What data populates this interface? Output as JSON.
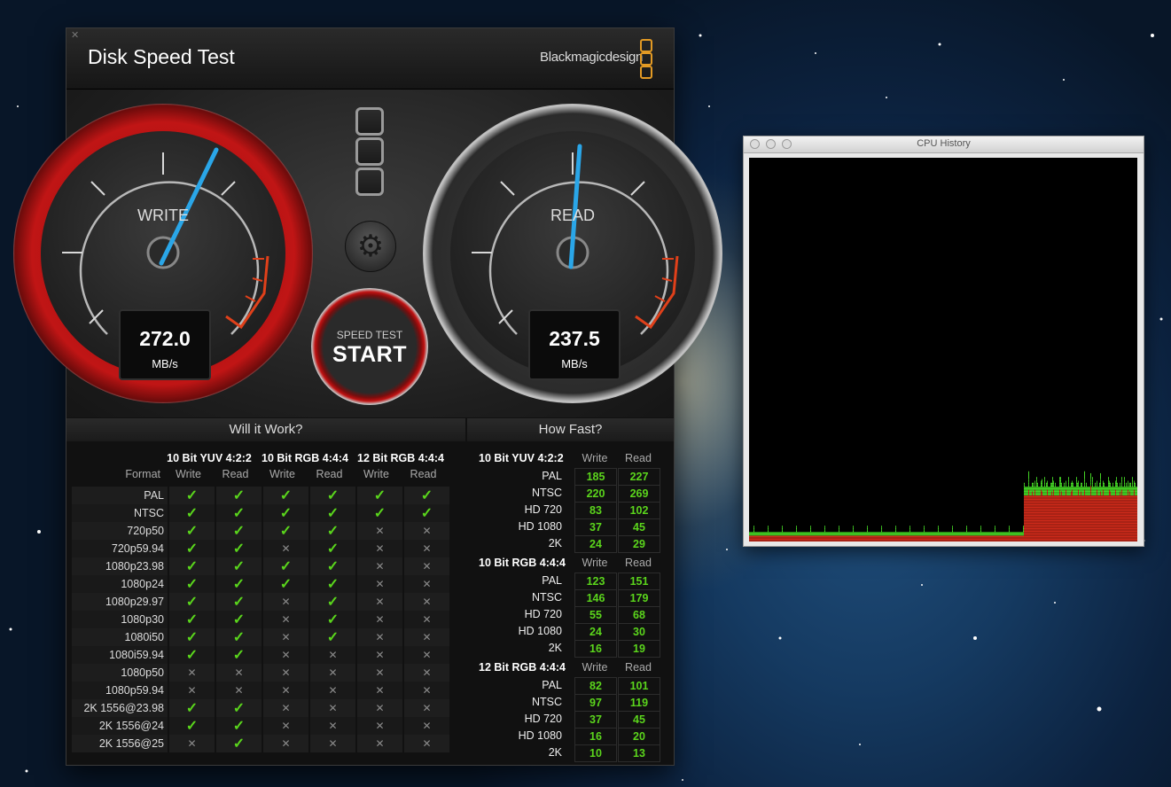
{
  "disk_speed_test": {
    "title": "Disk Speed Test",
    "brand": "Blackmagicdesign",
    "write_gauge": {
      "label": "WRITE",
      "value": "272.0",
      "unit": "MB/s"
    },
    "read_gauge": {
      "label": "READ",
      "value": "237.5",
      "unit": "MB/s"
    },
    "start_button": {
      "line1": "SPEED TEST",
      "line2": "START"
    },
    "will_it_work": {
      "title": "Will it Work?",
      "format_header": "Format",
      "groups": [
        "10 Bit YUV 4:2:2",
        "10 Bit RGB 4:4:4",
        "12 Bit RGB 4:4:4"
      ],
      "col_write": "Write",
      "col_read": "Read",
      "rows": [
        {
          "format": "PAL",
          "v": [
            1,
            1,
            1,
            1,
            1,
            1
          ]
        },
        {
          "format": "NTSC",
          "v": [
            1,
            1,
            1,
            1,
            1,
            1
          ]
        },
        {
          "format": "720p50",
          "v": [
            1,
            1,
            1,
            1,
            0,
            0
          ]
        },
        {
          "format": "720p59.94",
          "v": [
            1,
            1,
            0,
            1,
            0,
            0
          ]
        },
        {
          "format": "1080p23.98",
          "v": [
            1,
            1,
            1,
            1,
            0,
            0
          ]
        },
        {
          "format": "1080p24",
          "v": [
            1,
            1,
            1,
            1,
            0,
            0
          ]
        },
        {
          "format": "1080p29.97",
          "v": [
            1,
            1,
            0,
            1,
            0,
            0
          ]
        },
        {
          "format": "1080p30",
          "v": [
            1,
            1,
            0,
            1,
            0,
            0
          ]
        },
        {
          "format": "1080i50",
          "v": [
            1,
            1,
            0,
            1,
            0,
            0
          ]
        },
        {
          "format": "1080i59.94",
          "v": [
            1,
            1,
            0,
            0,
            0,
            0
          ]
        },
        {
          "format": "1080p50",
          "v": [
            0,
            0,
            0,
            0,
            0,
            0
          ]
        },
        {
          "format": "1080p59.94",
          "v": [
            0,
            0,
            0,
            0,
            0,
            0
          ]
        },
        {
          "format": "2K 1556@23.98",
          "v": [
            1,
            1,
            0,
            0,
            0,
            0
          ]
        },
        {
          "format": "2K 1556@24",
          "v": [
            1,
            1,
            0,
            0,
            0,
            0
          ]
        },
        {
          "format": "2K 1556@25",
          "v": [
            0,
            1,
            0,
            0,
            0,
            0
          ]
        }
      ],
      "check_symbol": "✓",
      "cross_symbol": "✕"
    },
    "how_fast": {
      "title": "How Fast?",
      "col_write": "Write",
      "col_read": "Read",
      "groups": [
        {
          "name": "10 Bit YUV 4:2:2",
          "rows": [
            {
              "label": "PAL",
              "write": "185",
              "read": "227"
            },
            {
              "label": "NTSC",
              "write": "220",
              "read": "269"
            },
            {
              "label": "HD 720",
              "write": "83",
              "read": "102"
            },
            {
              "label": "HD 1080",
              "write": "37",
              "read": "45"
            },
            {
              "label": "2K",
              "write": "24",
              "read": "29"
            }
          ]
        },
        {
          "name": "10 Bit RGB 4:4:4",
          "rows": [
            {
              "label": "PAL",
              "write": "123",
              "read": "151"
            },
            {
              "label": "NTSC",
              "write": "146",
              "read": "179"
            },
            {
              "label": "HD 720",
              "write": "55",
              "read": "68"
            },
            {
              "label": "HD 1080",
              "write": "24",
              "read": "30"
            },
            {
              "label": "2K",
              "write": "16",
              "read": "19"
            }
          ]
        },
        {
          "name": "12 Bit RGB 4:4:4",
          "rows": [
            {
              "label": "PAL",
              "write": "82",
              "read": "101"
            },
            {
              "label": "NTSC",
              "write": "97",
              "read": "119"
            },
            {
              "label": "HD 720",
              "write": "37",
              "read": "45"
            },
            {
              "label": "HD 1080",
              "write": "16",
              "read": "20"
            },
            {
              "label": "2K",
              "write": "10",
              "read": "13"
            }
          ]
        }
      ]
    }
  },
  "cpu_history": {
    "title": "CPU History",
    "colors": {
      "user": "#cc2a1a",
      "system": "#44d425",
      "background": "#000000"
    },
    "user_series": [
      3,
      3,
      3,
      3,
      3,
      3,
      3,
      3,
      3,
      3,
      3,
      3,
      3,
      3,
      3,
      3,
      3,
      3,
      3,
      3,
      3,
      3,
      3,
      3,
      3,
      3,
      3,
      3,
      3,
      3,
      3,
      3,
      3,
      3,
      3,
      3,
      3,
      3,
      3,
      3,
      3,
      3,
      3,
      3,
      3,
      3,
      3,
      3,
      3,
      3,
      3,
      3,
      3,
      3,
      3,
      3,
      3,
      3,
      3,
      3,
      3,
      3,
      3,
      3,
      3,
      3,
      3,
      3,
      3,
      3,
      3,
      3,
      3,
      3,
      3,
      3,
      3,
      3,
      3,
      3,
      3,
      3,
      3,
      3,
      3,
      3,
      3,
      3,
      3,
      3,
      3,
      3,
      3,
      3,
      3,
      3,
      3,
      3,
      3,
      3,
      3,
      3,
      3,
      3,
      3,
      3,
      3,
      3,
      3,
      3,
      3,
      3,
      3,
      3,
      3,
      3,
      3,
      3,
      3,
      3,
      3,
      3,
      3,
      3,
      3,
      3,
      3,
      3,
      3,
      3,
      3,
      3,
      3,
      3,
      3,
      3,
      3,
      3,
      3,
      3,
      3,
      3,
      3,
      3,
      3,
      3,
      3,
      3,
      3,
      3,
      3,
      3,
      3,
      3,
      3,
      3,
      3,
      3,
      3,
      3,
      3,
      3,
      3,
      3,
      3,
      3,
      3,
      3,
      3,
      3,
      3,
      3,
      3,
      3,
      3,
      3,
      3,
      3,
      3,
      3,
      3,
      3,
      3,
      3,
      3,
      3,
      3,
      3,
      3,
      3,
      3,
      3,
      3,
      3,
      3,
      3,
      3,
      3,
      3,
      3,
      3,
      3,
      3,
      3,
      3,
      3,
      3,
      3,
      3,
      3,
      3,
      3,
      3,
      3,
      3,
      3,
      3,
      3,
      3,
      3,
      3,
      3,
      3,
      3,
      3,
      3,
      3,
      3,
      3,
      3,
      3,
      3,
      3,
      3,
      3,
      3,
      3,
      3,
      3,
      3,
      3,
      3,
      3,
      3,
      3,
      3,
      3,
      3,
      3,
      3,
      3,
      3,
      3,
      3,
      3,
      3,
      3,
      3,
      3,
      3,
      3,
      3,
      3,
      3,
      3,
      3,
      3,
      3,
      3,
      3,
      3,
      3,
      3,
      3,
      3,
      3,
      3,
      3,
      3,
      3,
      3,
      3,
      3,
      3,
      3,
      3,
      3,
      3,
      3,
      3,
      3,
      3,
      3,
      3,
      3,
      3,
      3,
      3,
      3,
      3,
      3,
      3,
      3,
      3,
      3,
      3,
      3,
      3,
      3,
      3,
      3,
      3,
      3,
      3,
      3,
      3,
      3,
      3,
      3,
      3,
      3,
      3,
      3,
      3,
      3,
      3,
      3,
      3,
      3,
      3,
      3,
      3,
      3,
      3,
      3,
      3,
      3,
      3,
      3,
      3,
      3,
      3,
      3,
      3,
      3,
      3,
      3,
      3,
      3,
      3,
      3,
      3,
      3,
      3,
      3,
      3,
      3,
      3,
      3,
      3,
      3,
      3,
      3,
      3,
      3,
      3,
      3,
      3,
      3,
      3,
      3,
      3,
      3,
      3,
      3,
      3,
      3,
      3,
      3,
      3,
      3,
      3,
      3,
      3,
      3,
      3,
      3,
      3,
      3,
      3,
      3,
      3,
      3,
      3,
      3,
      3,
      3,
      3,
      3,
      3,
      3,
      3,
      3,
      3,
      3,
      3,
      3,
      3,
      3,
      3,
      3,
      3,
      3,
      3,
      3,
      3,
      3,
      3,
      3,
      3,
      3,
      3,
      3,
      3,
      3,
      3,
      3,
      3,
      3,
      3,
      3,
      3,
      3,
      3,
      3,
      3,
      3,
      3,
      3,
      3,
      3,
      3,
      3,
      3,
      3,
      3,
      3,
      3,
      3,
      3,
      3,
      3,
      3,
      3,
      3,
      3,
      3,
      3,
      3,
      3,
      3,
      3,
      3,
      3,
      3,
      3,
      3,
      3
    ],
    "system_series": [
      1,
      1,
      1,
      1,
      1,
      1,
      1,
      1,
      1,
      1,
      1,
      1,
      2,
      1,
      1,
      1,
      1,
      1,
      1,
      1,
      1,
      1,
      1,
      1,
      1,
      2,
      1,
      1,
      1,
      1,
      1,
      1,
      1,
      1,
      1,
      1,
      1,
      1,
      1,
      1,
      1,
      1,
      1,
      1,
      1,
      1,
      1,
      1,
      1,
      1,
      1,
      1,
      1,
      1,
      1,
      1,
      1,
      1,
      1,
      1,
      1,
      1,
      1,
      1,
      1,
      1,
      1,
      1,
      1,
      1,
      1,
      1,
      1,
      1,
      1,
      1,
      1,
      1,
      1,
      1,
      1,
      1,
      1,
      1,
      1,
      1,
      1,
      1,
      1,
      1,
      1,
      1,
      1,
      1,
      1,
      1,
      1,
      1,
      1,
      1,
      1,
      1,
      1,
      1,
      1,
      1,
      1,
      1,
      1,
      1,
      1,
      1,
      1,
      1,
      1,
      1,
      1,
      1,
      1,
      1,
      1,
      1,
      1,
      1,
      1,
      1,
      1,
      1,
      1,
      1,
      1,
      1,
      1,
      1,
      1,
      1,
      1,
      1,
      1,
      1,
      1,
      1,
      1,
      1,
      1,
      1,
      1,
      1,
      1,
      1,
      1,
      1,
      1,
      1,
      1,
      1,
      1,
      1,
      1,
      1,
      1,
      1,
      1,
      1,
      1,
      1,
      1,
      1,
      1,
      1,
      1,
      1,
      1,
      1,
      1,
      1,
      1,
      1,
      1,
      1,
      1,
      1,
      1,
      1,
      1,
      1,
      1,
      1,
      1,
      1,
      1,
      1,
      1,
      1,
      1,
      1,
      1,
      1,
      1,
      1,
      1,
      1,
      1,
      1,
      1,
      1,
      1,
      1,
      1,
      1,
      1,
      1,
      1,
      1,
      1,
      1,
      1,
      1,
      1,
      1,
      1,
      1,
      1,
      1,
      1,
      1,
      1,
      1,
      1,
      1,
      1,
      1,
      1,
      1,
      1,
      1,
      1,
      1,
      1,
      1,
      1,
      1,
      1,
      1,
      1,
      1,
      1,
      1,
      1,
      1,
      1,
      1,
      1,
      1,
      1,
      1,
      1,
      1,
      1,
      1,
      1,
      1,
      1,
      1,
      1,
      1,
      1,
      1,
      1,
      1,
      1,
      1,
      1,
      1,
      1,
      1,
      1,
      1,
      1,
      1,
      1,
      1,
      1,
      1,
      1,
      1,
      1,
      1,
      1,
      1,
      1,
      1,
      1,
      1,
      1,
      1,
      1,
      1,
      1,
      1,
      1,
      1,
      1,
      1,
      1,
      1,
      1,
      1,
      1,
      1,
      1,
      1,
      1,
      1,
      1,
      1,
      1,
      1,
      1,
      1,
      1,
      1,
      1,
      1,
      1,
      1,
      1,
      1,
      1,
      1,
      1,
      1,
      1,
      1,
      1,
      1,
      1,
      1,
      1,
      1,
      1,
      1,
      1,
      1,
      1,
      1,
      1,
      1,
      1,
      1,
      1,
      1,
      1,
      1,
      1,
      1,
      1,
      1,
      1,
      1,
      1,
      1,
      1,
      1,
      1,
      1,
      1,
      1,
      1,
      1,
      1,
      1,
      1,
      1,
      1,
      1,
      1,
      1,
      1,
      1,
      1,
      1,
      1,
      1,
      1,
      1,
      1,
      1,
      1,
      1,
      1,
      1,
      1,
      1,
      1,
      1,
      1,
      1,
      1,
      1,
      1,
      1,
      1,
      1,
      1,
      1,
      1,
      1,
      1,
      1,
      1,
      1,
      1,
      1,
      1,
      1,
      1,
      1,
      1,
      1,
      1,
      1,
      1,
      1,
      1,
      1,
      1,
      1,
      1,
      1,
      1,
      1,
      1,
      1,
      1,
      1,
      1,
      1,
      1,
      1,
      1,
      1,
      1,
      1,
      1,
      1,
      1,
      1,
      1,
      1,
      1,
      1,
      1,
      1,
      1,
      1,
      1,
      1,
      1,
      1,
      1,
      1,
      1,
      1,
      1,
      1,
      1,
      1,
      1,
      1,
      1,
      1,
      1,
      1,
      1,
      1,
      1,
      1,
      1,
      1,
      1,
      1,
      1,
      1,
      1,
      1,
      1,
      1,
      1,
      1,
      1,
      1,
      1,
      1,
      1,
      1,
      1,
      1,
      1,
      1,
      1,
      1,
      1,
      1,
      1,
      1,
      1
    ]
  }
}
